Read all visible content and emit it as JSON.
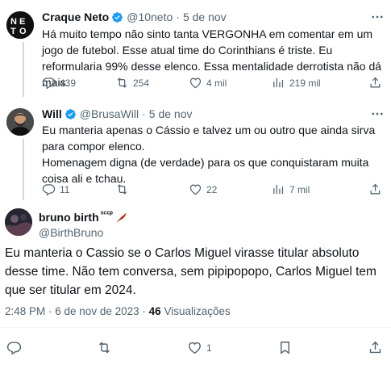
{
  "tweets": [
    {
      "name": "Craque Neto",
      "handle": "@10neto",
      "sep": "·",
      "date": "5 de nov",
      "text": "Há muito tempo não sinto tanta VERGONHA em comentar em um jogo de futebol. Esse atual time do Corinthians é triste. Eu reformularia 99% desse elenco. Essa mentalidade derrotista não dá mais.",
      "replies": "439",
      "retweets": "254",
      "likes": "4 mil",
      "views": "219 mil"
    },
    {
      "name": "Will",
      "handle": "@BrusaWill",
      "sep": "·",
      "date": "5 de nov",
      "text_line1": "Eu manteria apenas o Cássio e talvez um ou outro que ainda sirva para compor elenco.",
      "text_line2": "Homenagem digna (de verdade) para os que conquistaram muita coisa ali e tchau.",
      "replies": "11",
      "retweets": "",
      "likes": "22",
      "views": "7 mil"
    }
  ],
  "main_tweet": {
    "name": "bruno birth",
    "name_suffix": "ˢᶜᶜᵖ",
    "handle": "@BirthBruno",
    "text": "Eu manteria o Cassio se o Carlos Miguel virasse titular absoluto desse time. Não tem conversa, sem pipipopopo, Carlos Miguel tem que ser titular em 2024.",
    "time": "2:48 PM · 6 de nov de 2023 ·",
    "views_count": "46",
    "views_label": "Visualizações",
    "likes": "1"
  },
  "colors": {
    "verified": "#1d9bf0",
    "secondary": "#536471",
    "text": "#0f1419",
    "thread_line": "#cfd9de"
  },
  "icons": [
    "reply-icon",
    "retweet-icon",
    "like-icon",
    "views-icon",
    "share-icon",
    "more-icon",
    "verified-icon",
    "feather-icon"
  ]
}
